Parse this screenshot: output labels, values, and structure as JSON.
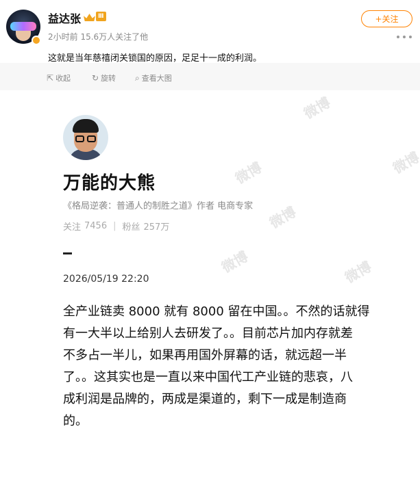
{
  "post": {
    "username": "益达张",
    "vip_level": "Ⅲ",
    "meta": "2小时前 15.6万人关注了他",
    "follow_label": "+关注",
    "text": "这就是当年慈禧闭关锁国的原因，足足十一成的利润。"
  },
  "actions": [
    {
      "icon": "star-icon",
      "label": "收起"
    },
    {
      "icon": "rotate-icon",
      "label": "旋转"
    },
    {
      "icon": "zoom-icon",
      "label": "查看大图"
    }
  ],
  "card": {
    "nickname": "万能的大熊",
    "bio": "《格局逆袭：普通人的制胜之道》作者 电商专家",
    "follow_label": "关注",
    "follow_count": "7456",
    "fans_label": "粉丝",
    "fans_count": "257万",
    "timestamp": "2026/05/19 22:20",
    "body_lines": [
      "全产业链卖 8000 就有 8000 留在中国。。不然的话就得",
      "有一大半以上给别人去研发了。。目前芯片加内存就差",
      "不多占一半儿，如果再用国外屏幕的话，就远超一半",
      "了。。这其实也是一直以来中国代工产业链的悲哀，八",
      "成利润是品牌的，两成是渠道的，剩下一成是制造商",
      "的。"
    ],
    "watermark": "微博"
  },
  "colors": {
    "accent": "#ff8200",
    "vip": "#f0a41e"
  }
}
